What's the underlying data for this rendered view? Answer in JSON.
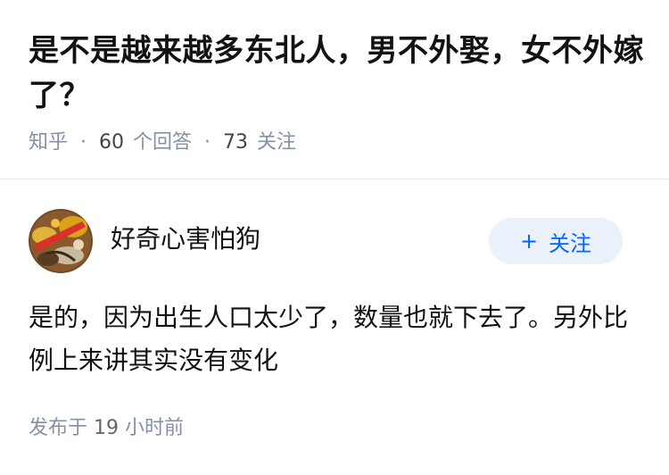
{
  "question": {
    "title": "是不是越来越多东北人，男不外娶，女不外嫁了？",
    "source": "知乎",
    "answer_count": "60",
    "answer_label": "个回答",
    "follow_count": "73",
    "follow_label": "关注",
    "separator": "·"
  },
  "answer": {
    "author_name": "好奇心害怕狗",
    "follow_button_icon": "+",
    "follow_button_label": "关注",
    "content": "是的，因为出生人口太少了，数量也就下去了。另外比例上来讲其实没有变化",
    "time_prefix": "发布于",
    "time_value": "19",
    "time_suffix": "小时前"
  },
  "colors": {
    "text_primary": "#121212",
    "text_meta": "#8590a6",
    "accent_blue": "#0066ff",
    "button_bg": "#ebf1fa",
    "divider": "#ebebeb"
  },
  "icons": {
    "avatar": "user-avatar-food-photo",
    "follow": "plus-icon"
  }
}
